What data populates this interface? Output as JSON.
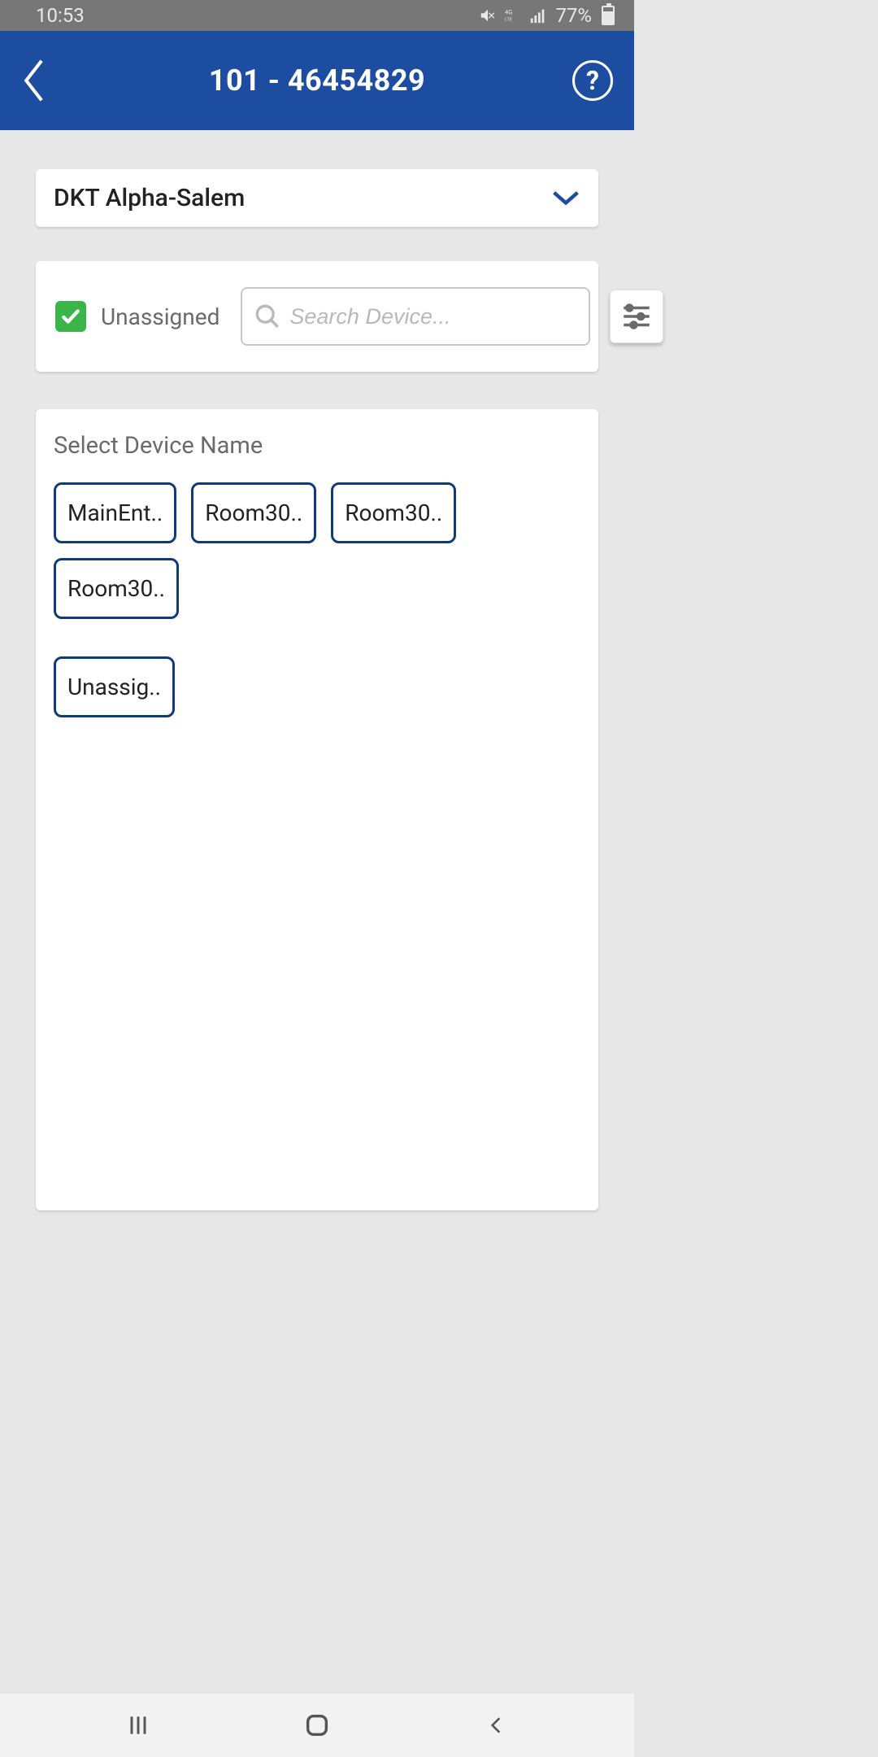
{
  "status": {
    "time": "10:53",
    "battery_pct": "77%"
  },
  "header": {
    "title": "101 - 46454829"
  },
  "location_dropdown": {
    "selected": "DKT Alpha-Salem"
  },
  "filters": {
    "checkbox_label": "Unassigned",
    "search_placeholder": "Search Device..."
  },
  "device_section": {
    "heading": "Select Device Name",
    "chips": [
      "MainEnt..",
      "Room30..",
      "Room30..",
      "Room30..",
      "Unassig.."
    ]
  },
  "colors": {
    "primary": "#1c4da1",
    "chip_border": "#0f3a7c",
    "check_green": "#3bb54a"
  }
}
